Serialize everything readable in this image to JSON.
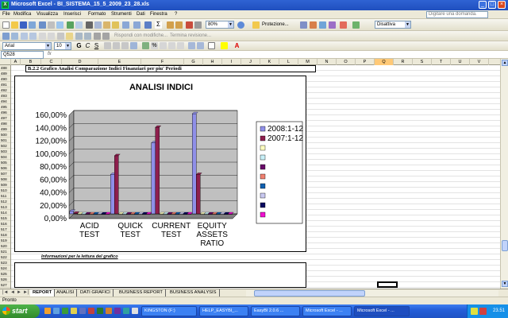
{
  "app": {
    "title": "Microsoft Excel - BI_SISTEMA_15_5_2009_23_28.xls",
    "icon_label": "X"
  },
  "menu": [
    "File",
    "Modifica",
    "Visualizza",
    "Inserisci",
    "Formato",
    "Strumenti",
    "Dati",
    "Finestra",
    "?"
  ],
  "ask_box": "Digitare una domanda.",
  "toolbar": {
    "zoom": "80%",
    "protection": "Protezione...",
    "dropdown": "Disattiva",
    "reply": "Rispondi con modifiche...",
    "end_review": "Termina revisione...",
    "font": "Arial",
    "size": "10"
  },
  "formula_bar": {
    "name_box": "Q528",
    "fx": "fx",
    "content": ""
  },
  "columns": [
    "A",
    "B",
    "C",
    "D",
    "E",
    "F",
    "G",
    "H",
    "I",
    "J",
    "K",
    "L",
    "M",
    "N",
    "O",
    "P",
    "Q",
    "R",
    "S",
    "T",
    "U",
    "V"
  ],
  "selected_column": "Q",
  "rows": [
    "488",
    "489",
    "490",
    "491",
    "492",
    "493",
    "494",
    "495",
    "496",
    "497",
    "498",
    "499",
    "500",
    "501",
    "502",
    "503",
    "504",
    "505",
    "506",
    "507",
    "508",
    "509",
    "510",
    "511",
    "512",
    "513",
    "514",
    "515",
    "516",
    "517",
    "518",
    "519",
    "520",
    "521",
    "522",
    "523",
    "524",
    "525",
    "526",
    "527",
    "528"
  ],
  "sheet": {
    "heading": "B.2.2 Grafico Analisi Comparazione Indici Finanziari per piu' Periodi",
    "info_label": "Informazioni per la lettura del grafico"
  },
  "chart_data": {
    "type": "bar",
    "title": "ANALISI INDICI",
    "categories": [
      [
        "ACID",
        "TEST"
      ],
      [
        "QUICK",
        "TEST"
      ],
      [
        "CURRENT",
        "TEST"
      ],
      [
        "EQUITY",
        "ASSETS",
        "RATIO"
      ]
    ],
    "series": [
      {
        "name": "2008:1-12",
        "values": [
          4,
          61,
          110,
          155
        ],
        "color": "#8f8fe8"
      },
      {
        "name": "2007:1-12",
        "values": [
          1,
          90,
          134,
          61
        ],
        "color": "#8e1f4d"
      },
      {
        "name": "",
        "values": [
          0,
          0,
          0,
          0
        ],
        "color": "#ffffc0"
      },
      {
        "name": "",
        "values": [
          0,
          0,
          0,
          0
        ],
        "color": "#c8f0f8"
      },
      {
        "name": "",
        "values": [
          0,
          0,
          0,
          0
        ],
        "color": "#6a0a6a"
      },
      {
        "name": "",
        "values": [
          0,
          0,
          0,
          0
        ],
        "color": "#f08070"
      },
      {
        "name": "",
        "values": [
          0,
          0,
          0,
          0
        ],
        "color": "#1060b0"
      },
      {
        "name": "",
        "values": [
          0,
          0,
          0,
          0
        ],
        "color": "#c8c8f0"
      },
      {
        "name": "",
        "values": [
          0,
          0,
          0,
          0
        ],
        "color": "#0a0a60"
      },
      {
        "name": "",
        "values": [
          0,
          0,
          0,
          0
        ],
        "color": "#f010d0"
      }
    ],
    "yticks": [
      "0,00%",
      "20,00%",
      "40,00%",
      "60,00%",
      "80,00%",
      "100,00%",
      "120,00%",
      "140,00%",
      "160,00%"
    ],
    "ylim": [
      0,
      160
    ],
    "plot_background": "#c0c0c0",
    "legend_position": "right"
  },
  "sheet_tabs": [
    "REPORT",
    "ANALISI",
    "DATI GRAFICI",
    "BUSINESS REPORT",
    "BUSINESS ANALYSIS"
  ],
  "active_tab": "REPORT",
  "status": "Pronto",
  "taskbar": {
    "start": "start",
    "buttons": [
      "KINGSTON (F:)",
      "HELP_EASYBI_...",
      "EasyBI 2.0.6 ...",
      "Microsoft Excel - ...",
      "Microsoft Excel - ..."
    ],
    "clock": "23.51"
  }
}
